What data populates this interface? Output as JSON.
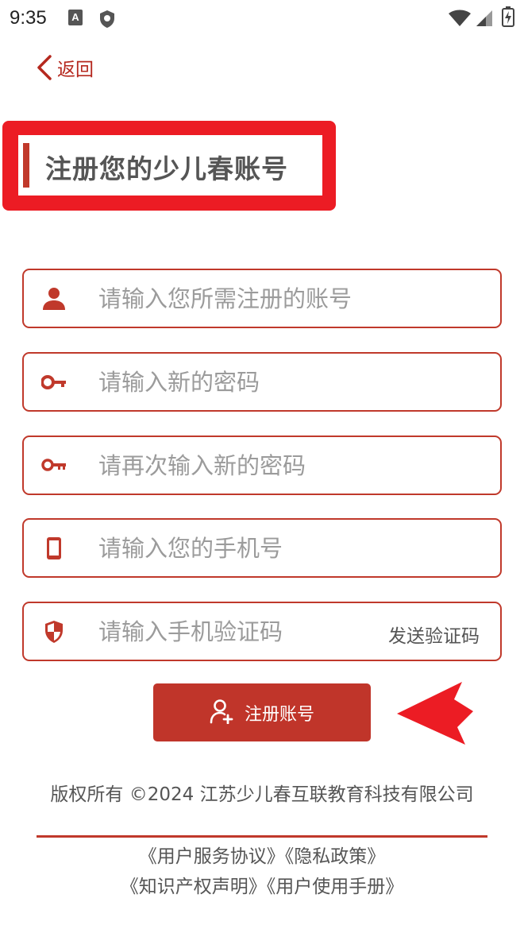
{
  "status_bar": {
    "time": "9:35",
    "notification_icons": [
      "a11y-a-icon",
      "shield-icon"
    ],
    "system_icons": [
      "wifi-icon",
      "signal-icon",
      "battery-icon"
    ]
  },
  "back": {
    "label": "返回",
    "icon": "chevron-left-icon"
  },
  "title": "注册您的少儿春账号",
  "fields": [
    {
      "icon": "user-icon",
      "placeholder": "请输入您所需注册的账号",
      "value": ""
    },
    {
      "icon": "key-icon",
      "placeholder": "请输入新的密码",
      "value": ""
    },
    {
      "icon": "key-icon",
      "placeholder": "请再次输入新的密码",
      "value": ""
    },
    {
      "icon": "phone-icon",
      "placeholder": "请输入您的手机号",
      "value": ""
    },
    {
      "icon": "shield-icon",
      "placeholder": "请输入手机验证码",
      "value": ""
    }
  ],
  "send_code_label": "发送验证码",
  "register_button": {
    "label": "注册账号",
    "icon": "add-user-icon"
  },
  "footer": {
    "copyright": "版权所有 ©2024 江苏少儿春互联教育科技有限公司",
    "links_row1": [
      "《用户服务协议》",
      "《隐私政策》"
    ],
    "links_row2": [
      "《知识产权声明》",
      "《用户使用手册》"
    ]
  },
  "colors": {
    "accent": "#c0392b",
    "highlight_annotation": "#ec1c24",
    "button": "#c0352a",
    "placeholder": "#9b9b9b"
  }
}
